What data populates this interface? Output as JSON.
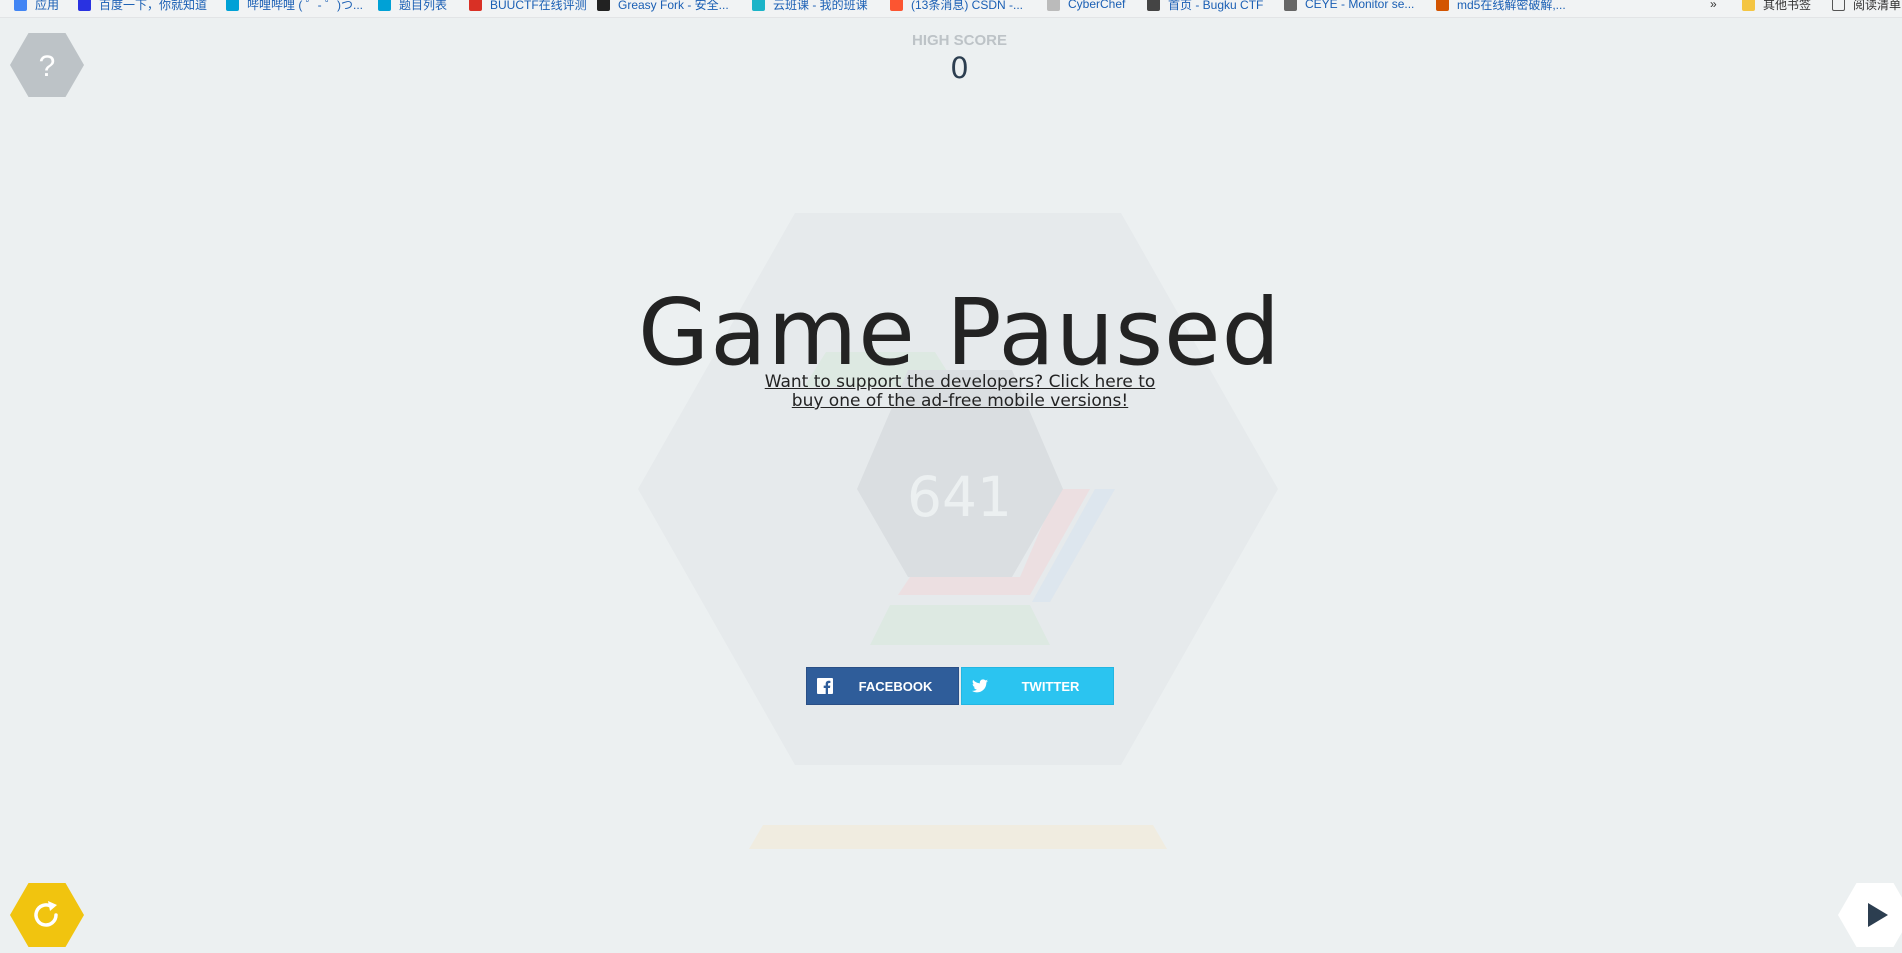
{
  "bookmarks": [
    {
      "label": "应用",
      "color": "#4285f4"
    },
    {
      "label": "百度一下，你就知道",
      "color": "#2932e1"
    },
    {
      "label": "哔哩哔哩 ( ゜- ゜)つ...",
      "color": "#00a1d6"
    },
    {
      "label": "题目列表",
      "color": "#00a1d6"
    },
    {
      "label": "BUUCTF在线评测",
      "color": "#d93025"
    },
    {
      "label": "Greasy Fork - 安全...",
      "color": "#222222"
    },
    {
      "label": "云班课 - 我的班课",
      "color": "#1bb4c8"
    },
    {
      "label": "(13条消息) CSDN -...",
      "color": "#fc5531"
    },
    {
      "label": "CyberChef",
      "color": "#bbbbbb"
    },
    {
      "label": "首页 - Bugku CTF",
      "color": "#444444"
    },
    {
      "label": "CEYE - Monitor se...",
      "color": "#666666"
    },
    {
      "label": "md5在线解密破解,...",
      "color": "#d35400"
    }
  ],
  "bookmarks_overflow": "»",
  "other_bookmarks": "其他书签",
  "reading_list": "阅读清单",
  "high_score_label": "HIGH SCORE",
  "high_score_value": "0",
  "title": "Game Paused",
  "support_text": "Want to support the developers? Click here to buy one of the ad-free mobile versions!",
  "score": "641",
  "facebook_label": "FACEBOOK",
  "twitter_label": "TWITTER",
  "help_label": "?",
  "colors": {
    "background": "#ecf0f1",
    "facebook": "#2f5d9a",
    "twitter": "#2bc4f0",
    "restart": "#f1c40f",
    "help": "#bdc3c7"
  }
}
